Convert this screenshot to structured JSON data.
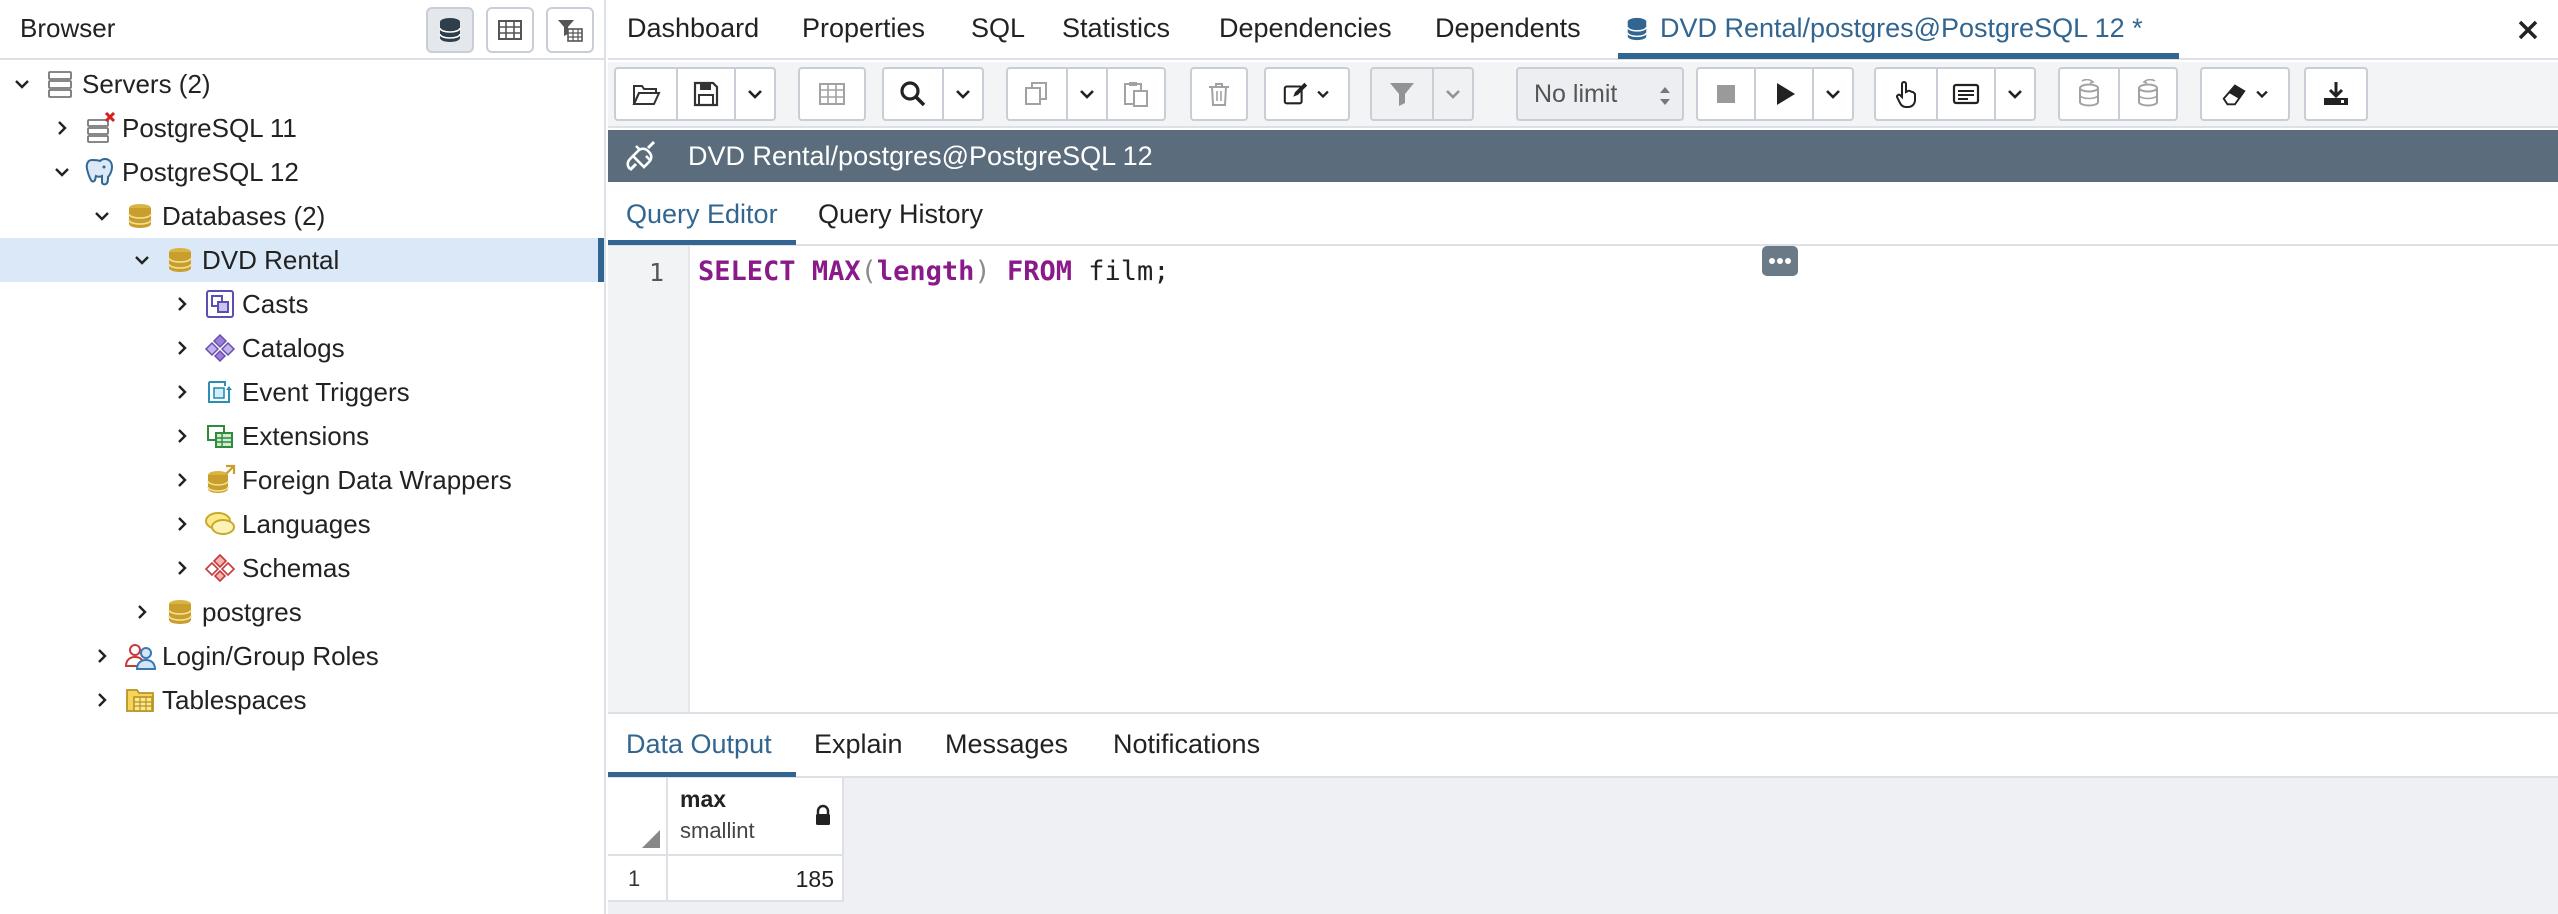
{
  "browser": {
    "title": "Browser",
    "tree": [
      {
        "label": "Servers (2)",
        "icon": "servers-icon",
        "chevron": "down"
      },
      {
        "label": "PostgreSQL 11",
        "icon": "server-disconnected-icon",
        "chevron": "right"
      },
      {
        "label": "PostgreSQL 12",
        "icon": "postgres-elephant-icon",
        "chevron": "down"
      },
      {
        "label": "Databases (2)",
        "icon": "databases-icon",
        "chevron": "down"
      },
      {
        "label": "DVD Rental",
        "icon": "database-icon",
        "chevron": "down"
      },
      {
        "label": "Casts",
        "icon": "casts-icon",
        "chevron": "right"
      },
      {
        "label": "Catalogs",
        "icon": "catalogs-icon",
        "chevron": "right"
      },
      {
        "label": "Event Triggers",
        "icon": "event-triggers-icon",
        "chevron": "right"
      },
      {
        "label": "Extensions",
        "icon": "extensions-icon",
        "chevron": "right"
      },
      {
        "label": "Foreign Data Wrappers",
        "icon": "foreign-data-wrappers-icon",
        "chevron": "right"
      },
      {
        "label": "Languages",
        "icon": "languages-icon",
        "chevron": "right"
      },
      {
        "label": "Schemas",
        "icon": "schemas-icon",
        "chevron": "right"
      },
      {
        "label": "postgres",
        "icon": "database-icon",
        "chevron": "right"
      },
      {
        "label": "Login/Group Roles",
        "icon": "roles-icon",
        "chevron": "right"
      },
      {
        "label": "Tablespaces",
        "icon": "tablespaces-icon",
        "chevron": "right"
      }
    ]
  },
  "tabs": {
    "items": [
      "Dashboard",
      "Properties",
      "SQL",
      "Statistics",
      "Dependencies",
      "Dependents"
    ],
    "active": "DVD Rental/postgres@PostgreSQL 12 *"
  },
  "toolbar": {
    "limit": "No limit"
  },
  "connection": {
    "label": "DVD Rental/postgres@PostgreSQL 12"
  },
  "editor_tabs": [
    "Query Editor",
    "Query History"
  ],
  "editor": {
    "line_number": "1",
    "code": {
      "kw1": "SELECT",
      "fn": "MAX",
      "open": "(",
      "col": "length",
      "close": ")",
      "kw2": "FROM",
      "rest": " film;"
    }
  },
  "output_tabs": [
    "Data Output",
    "Explain",
    "Messages",
    "Notifications"
  ],
  "grid": {
    "column": {
      "name": "max",
      "type": "smallint"
    },
    "rows": [
      {
        "number": "1",
        "value": "185"
      }
    ]
  },
  "colors": {
    "accent": "#326690",
    "connection_bar": "#5b6d7c",
    "keyword": "#8a1a8a"
  }
}
